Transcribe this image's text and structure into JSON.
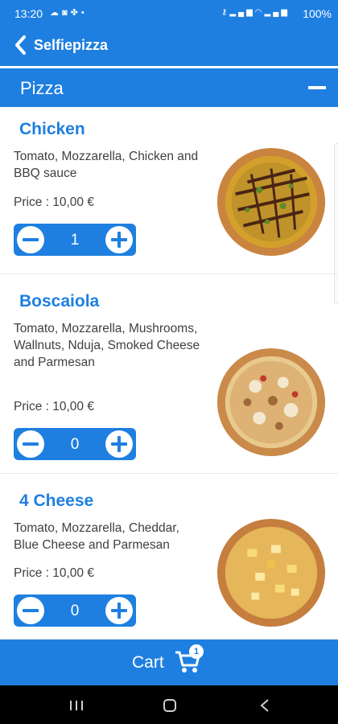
{
  "status_bar": {
    "time": "13:20",
    "left_icons": [
      "cloud-icon",
      "instagram-icon",
      "android-icon",
      "dot-icon"
    ],
    "right_icons": [
      "key-icon",
      "signal-icon",
      "wifi-icon",
      "signal-icon"
    ],
    "battery": "100%"
  },
  "app_bar": {
    "back_icon": "chevron-left-icon",
    "title": "Selfiepizza"
  },
  "category": {
    "label": "Pizza",
    "collapse_icon": "minus-icon"
  },
  "items": [
    {
      "name": "Chicken",
      "description": "Tomato, Mozzarella, Chicken and BBQ sauce",
      "price": "Price : 10,00 €",
      "quantity": "1",
      "minus_icon": "minus-circle-icon",
      "plus_icon": "plus-circle-icon"
    },
    {
      "name": "Boscaiola",
      "description": "Tomato, Mozzarella, Mushrooms, Wallnuts, Nduja, Smoked Cheese and Parmesan",
      "price": "Price : 10,00 €",
      "quantity": "0",
      "minus_icon": "minus-circle-icon",
      "plus_icon": "plus-circle-icon"
    },
    {
      "name": "4 Cheese",
      "description": "Tomato, Mozzarella, Cheddar, Blue Cheese and Parmesan",
      "price": "Price : 10,00 €",
      "quantity": "0",
      "minus_icon": "minus-circle-icon",
      "plus_icon": "plus-circle-icon"
    }
  ],
  "cart": {
    "label": "Cart",
    "count": "1",
    "icon": "shopping-cart-icon"
  },
  "nav_bar": {
    "icons": [
      "recent-apps-icon",
      "home-icon",
      "back-icon"
    ]
  },
  "colors": {
    "accent": "#1e7fe0",
    "text": "#404040",
    "background": "#ffffff"
  }
}
